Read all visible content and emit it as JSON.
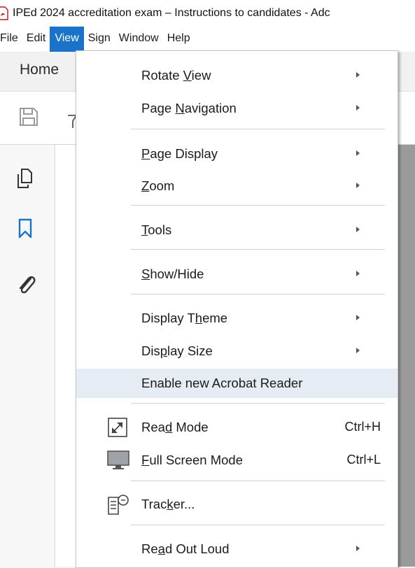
{
  "window": {
    "title": "IPEd 2024 accreditation exam – Instructions to candidates - Adc"
  },
  "menubar": {
    "items": [
      "File",
      "Edit",
      "View",
      "Sign",
      "Window",
      "Help"
    ]
  },
  "tabs": {
    "home": "Home"
  },
  "dropdown": {
    "rotate_view": {
      "pre": "Rotate ",
      "key": "V",
      "post": "iew"
    },
    "page_navigation": {
      "pre": "Page ",
      "key": "N",
      "post": "avigation"
    },
    "page_display": {
      "pre": "",
      "key": "P",
      "post": "age Display"
    },
    "zoom": {
      "pre": "",
      "key": "Z",
      "post": "oom"
    },
    "tools": {
      "pre": "",
      "key": "T",
      "post": "ools"
    },
    "show_hide": {
      "pre": "",
      "key": "S",
      "post": "how/Hide"
    },
    "display_theme": {
      "pre": "Display T",
      "key": "h",
      "post": "eme"
    },
    "display_size": {
      "pre": "Dis",
      "key": "p",
      "post": "lay Size"
    },
    "enable_new_reader": {
      "label": "Enable new Acrobat Reader"
    },
    "read_mode": {
      "pre": "Rea",
      "key": "d",
      "post": " Mode",
      "shortcut": "Ctrl+H"
    },
    "full_screen": {
      "pre": "",
      "key": "F",
      "post": "ull Screen Mode",
      "shortcut": "Ctrl+L"
    },
    "tracker": {
      "pre": "Trac",
      "key": "k",
      "post": "er..."
    },
    "read_out_loud": {
      "pre": "Re",
      "key": "a",
      "post": "d Out Loud"
    }
  },
  "icons": {
    "app": "acrobat-pdf-icon",
    "save": "save-icon",
    "pages": "page-thumbnails-icon",
    "bookmarks": "bookmark-icon",
    "attachments": "paperclip-icon",
    "read_mode": "read-mode-icon",
    "full_screen": "full-screen-monitor-icon",
    "tracker": "tracker-icon"
  },
  "colors": {
    "accent": "#1a73c9",
    "highlight": "#e5ecf4",
    "bookmark_blue": "#1a73c9"
  }
}
